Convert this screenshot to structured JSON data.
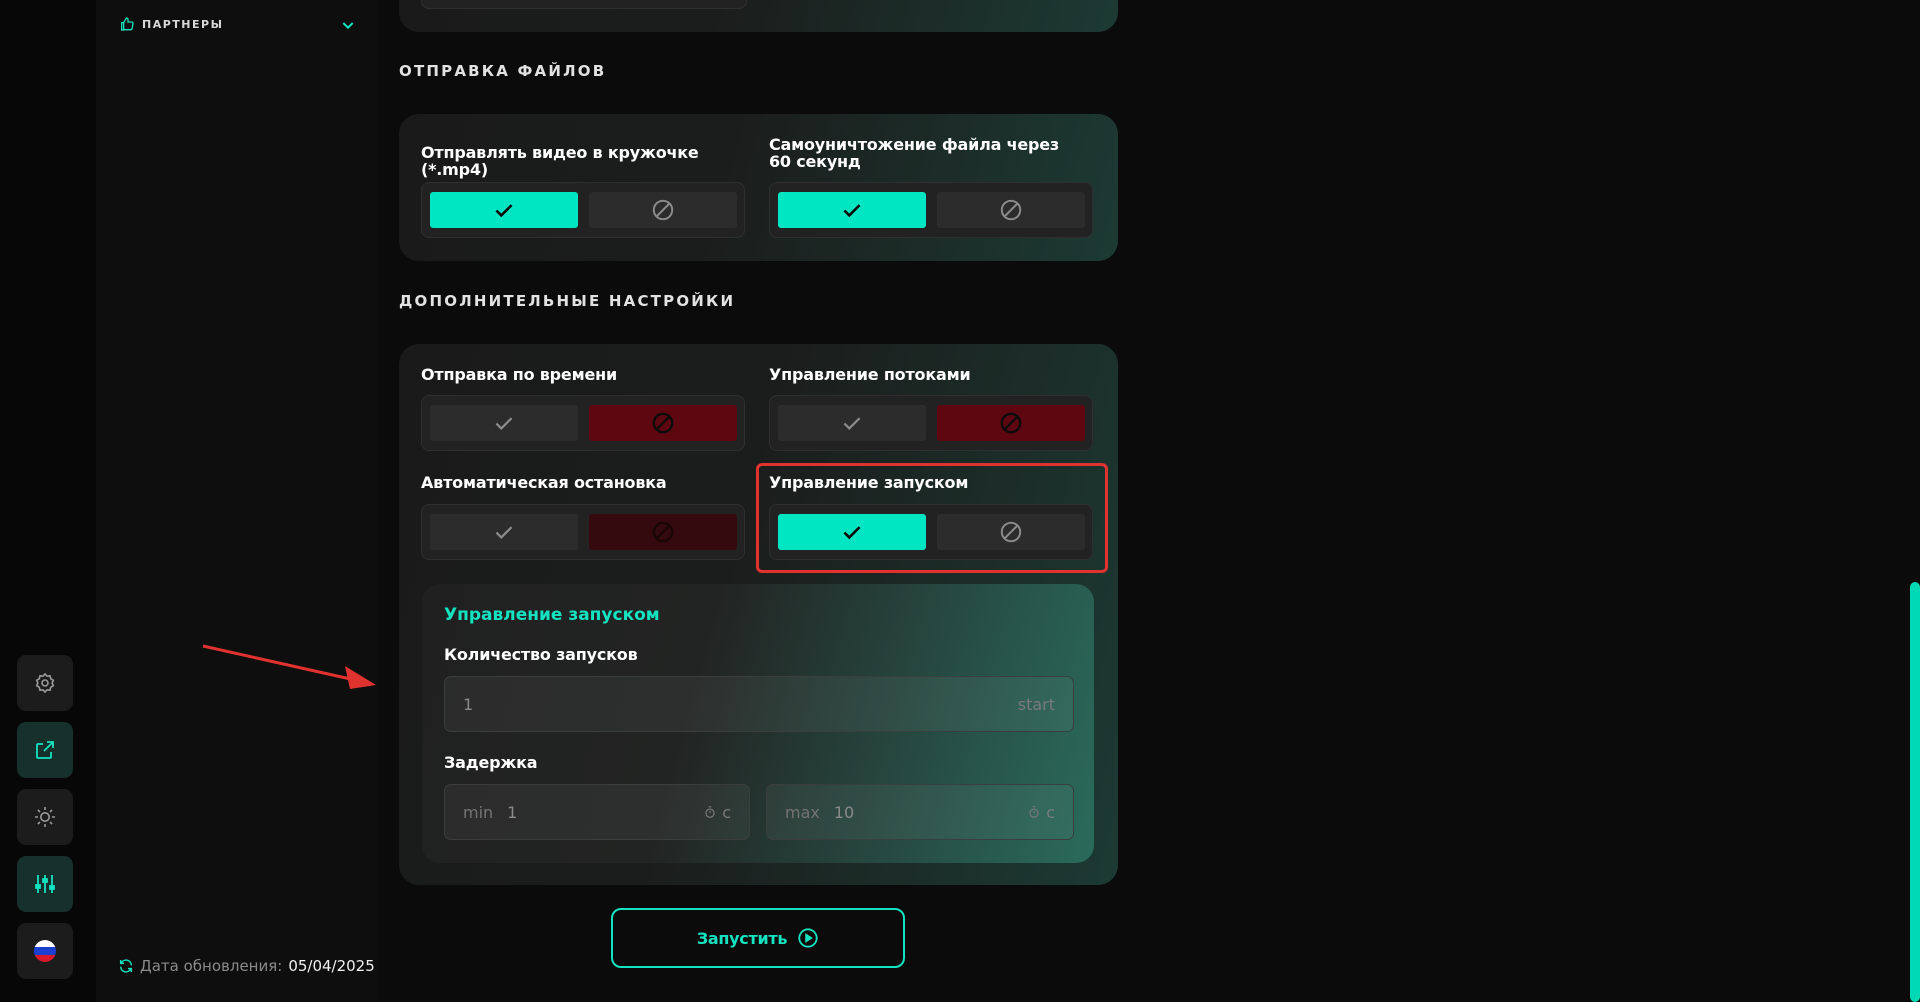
{
  "sidebar": {
    "partners_label": "ПАРТНЕРЫ",
    "update_label": "Дата обновления:",
    "update_date": "05/04/2025",
    "rail_icons": [
      "gear-icon",
      "external-link-icon",
      "sun-icon",
      "sliders-icon",
      "russia-flag-icon"
    ]
  },
  "file_sending": {
    "title": "ОТПРАВКА ФАЙЛОВ",
    "video_circle": {
      "label": "Отправлять видео в кружочке (*.mp4)",
      "enabled": true
    },
    "self_destruct": {
      "label": "Самоуничтожение файла через 60 секунд",
      "enabled": true
    }
  },
  "extra_settings": {
    "title": "ДОПОЛНИТЕЛЬНЫЕ НАСТРОЙКИ",
    "time_sending": {
      "label": "Отправка по времени",
      "enabled": false
    },
    "thread_control": {
      "label": "Управление потоками",
      "enabled": false
    },
    "auto_stop": {
      "label": "Автоматическая остановка",
      "enabled": false
    },
    "launch_control": {
      "label": "Управление запуском",
      "enabled": true
    }
  },
  "launch_panel": {
    "title": "Управление запуском",
    "count_label": "Количество запусков",
    "count_value": "1",
    "count_suffix": "start",
    "delay_label": "Задержка",
    "min_prefix": "min",
    "min_value": "1",
    "max_prefix": "max",
    "max_value": "10",
    "unit": "c"
  },
  "run_button": {
    "label": "Запустить"
  },
  "colors": {
    "accent": "#00e6c3",
    "danger": "#5e0711",
    "highlight": "#e0322f"
  }
}
